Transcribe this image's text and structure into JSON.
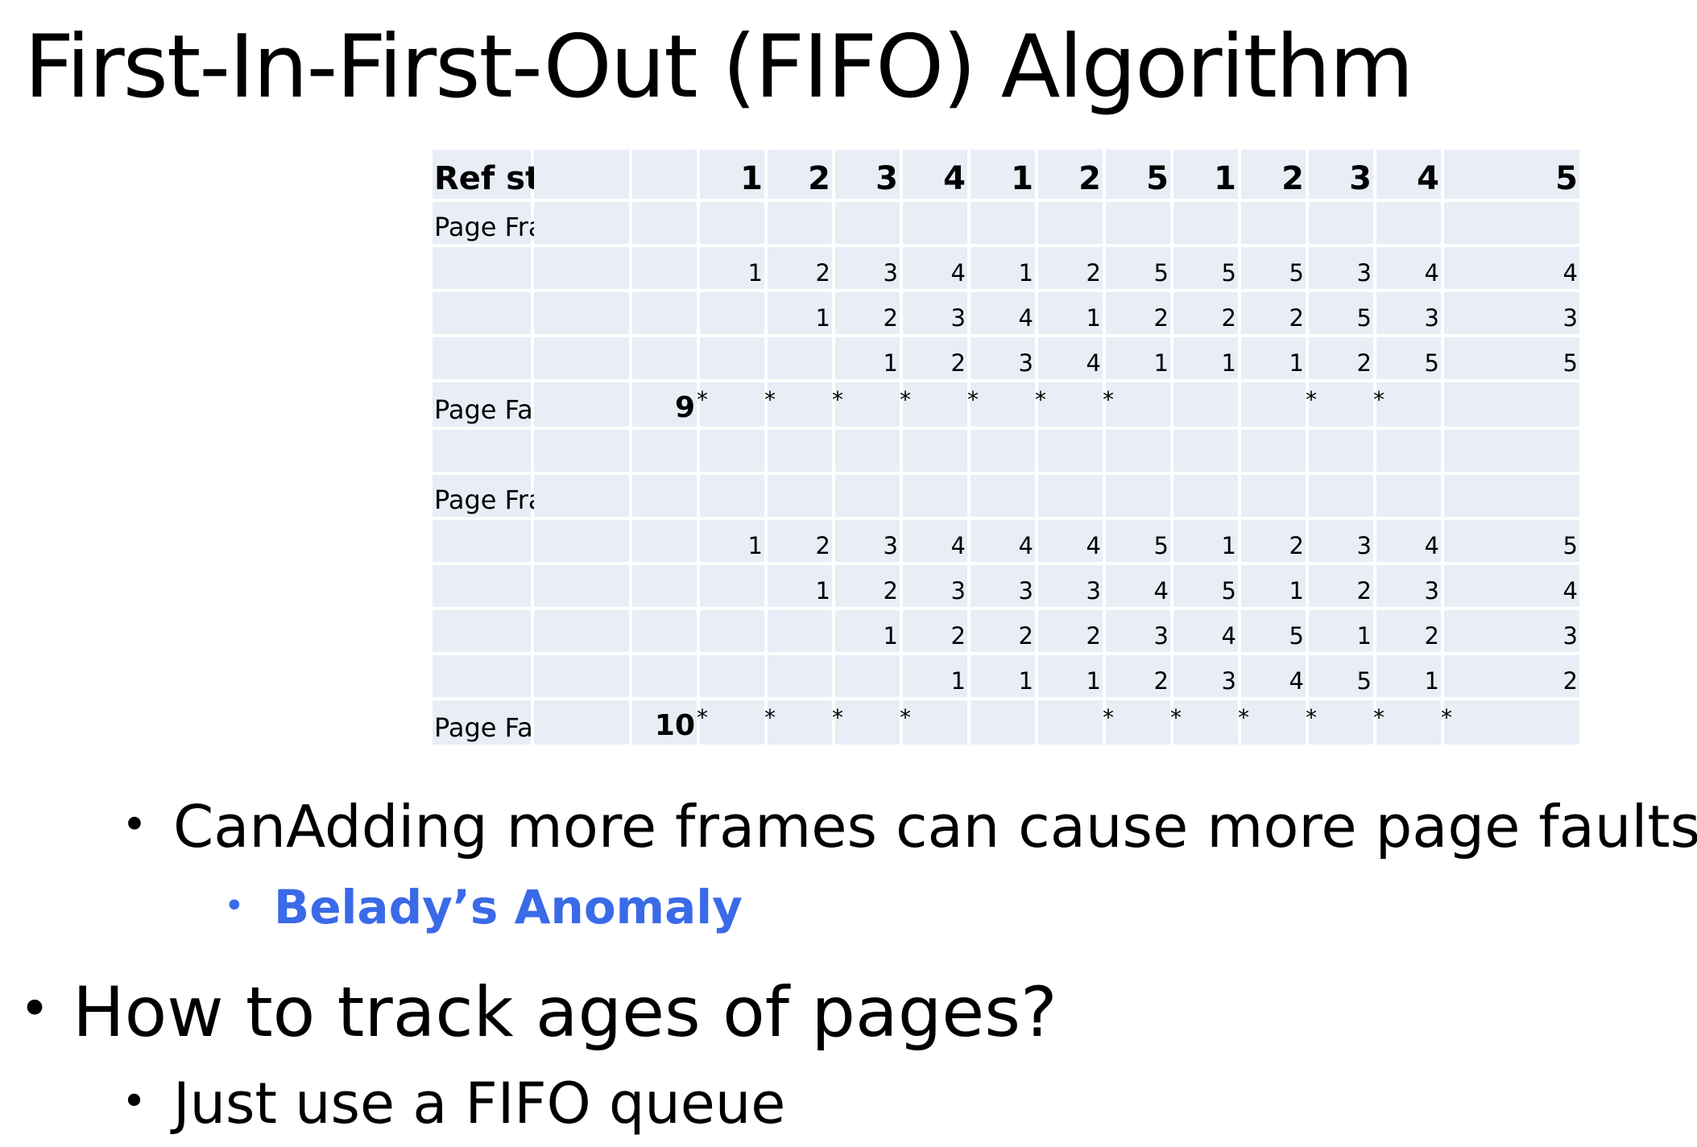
{
  "title": "First-In-First-Out (FIFO) Algorithm",
  "table": {
    "ref_label": "Ref string",
    "ref_string": [
      "1",
      "2",
      "3",
      "4",
      "1",
      "2",
      "5",
      "1",
      "2",
      "3",
      "4",
      "5"
    ],
    "sections": [
      {
        "frames_label": "Page Frames",
        "frames": [
          [
            "1",
            "2",
            "3",
            "4",
            "1",
            "2",
            "5",
            "5",
            "5",
            "3",
            "4",
            "4"
          ],
          [
            "",
            "1",
            "2",
            "3",
            "4",
            "1",
            "2",
            "2",
            "2",
            "5",
            "3",
            "3"
          ],
          [
            "",
            "",
            "1",
            "2",
            "3",
            "4",
            "1",
            "1",
            "1",
            "2",
            "5",
            "5"
          ]
        ],
        "fault_label": "Page Fault",
        "fault_total": "9",
        "faults": [
          "*",
          "*",
          "*",
          "*",
          "*",
          "*",
          "*",
          "",
          "",
          "*",
          "*",
          ""
        ]
      },
      {
        "frames_label": "Page Frames",
        "frames": [
          [
            "1",
            "2",
            "3",
            "4",
            "4",
            "4",
            "5",
            "1",
            "2",
            "3",
            "4",
            "5"
          ],
          [
            "",
            "1",
            "2",
            "3",
            "3",
            "3",
            "4",
            "5",
            "1",
            "2",
            "3",
            "4"
          ],
          [
            "",
            "",
            "1",
            "2",
            "2",
            "2",
            "3",
            "4",
            "5",
            "1",
            "2",
            "3"
          ],
          [
            "",
            "",
            "",
            "1",
            "1",
            "1",
            "2",
            "3",
            "4",
            "5",
            "1",
            "2"
          ]
        ],
        "fault_label": "Page Fault",
        "fault_total": "10",
        "faults": [
          "*",
          "*",
          "*",
          "*",
          "",
          "",
          "*",
          "*",
          "*",
          "*",
          "*",
          "*"
        ]
      }
    ]
  },
  "bullets": [
    {
      "text": "CanAdding more frames can cause more page faults!",
      "level": 2
    },
    {
      "text": "Belady’s Anomaly",
      "level": 3,
      "color": "#3a6ae8"
    },
    {
      "text": "How to track ages of pages?",
      "level": 1
    },
    {
      "text": "Just use a FIFO queue",
      "level": 2
    }
  ]
}
